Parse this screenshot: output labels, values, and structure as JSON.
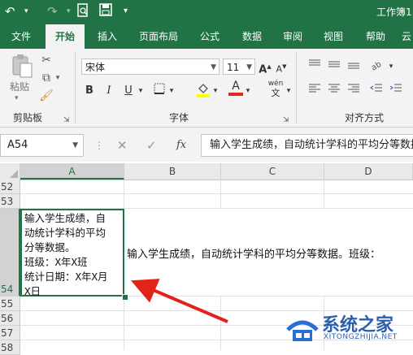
{
  "app": {
    "title": "工作簿1.",
    "accent": "#217346"
  },
  "quick_access": {
    "undo": "↶",
    "redo": "↷",
    "print_preview": "🗋",
    "save": "💾"
  },
  "ribbon_tabs": [
    "文件",
    "开始",
    "插入",
    "页面布局",
    "公式",
    "数据",
    "审阅",
    "视图",
    "帮助",
    "云"
  ],
  "active_tab": "开始",
  "clipboard": {
    "paste_label": "粘贴",
    "group_label": "剪贴板"
  },
  "font": {
    "name": "宋体",
    "size": "11",
    "group_label": "字体",
    "bold": "B",
    "italic": "I",
    "underline": "U",
    "grow": "A",
    "shrink": "A",
    "phonetic": "wén",
    "font_color_letter": "A"
  },
  "alignment": {
    "group_label": "对齐方式"
  },
  "formula_bar": {
    "name_box": "A54",
    "cancel": "✕",
    "enter": "✓",
    "fx": "fx",
    "content": "输入学生成绩，自动统计学科的平均分等数据。班级："
  },
  "columns": [
    "A",
    "B",
    "C",
    "D"
  ],
  "rows": [
    "52",
    "53",
    "54",
    "55",
    "56",
    "57",
    "58"
  ],
  "cell_a54": {
    "lines": [
      "输入学生成绩，自",
      "动统计学科的平均",
      "分等数据。",
      "班级：X年X班",
      "统计日期：X年X月",
      "X日"
    ]
  },
  "overflow_text": "输入学生成绩，自动统计学科的平均分等数据。班级：",
  "watermark": {
    "name": "系统之家",
    "url": "XITONGZHIJIA.NET"
  }
}
